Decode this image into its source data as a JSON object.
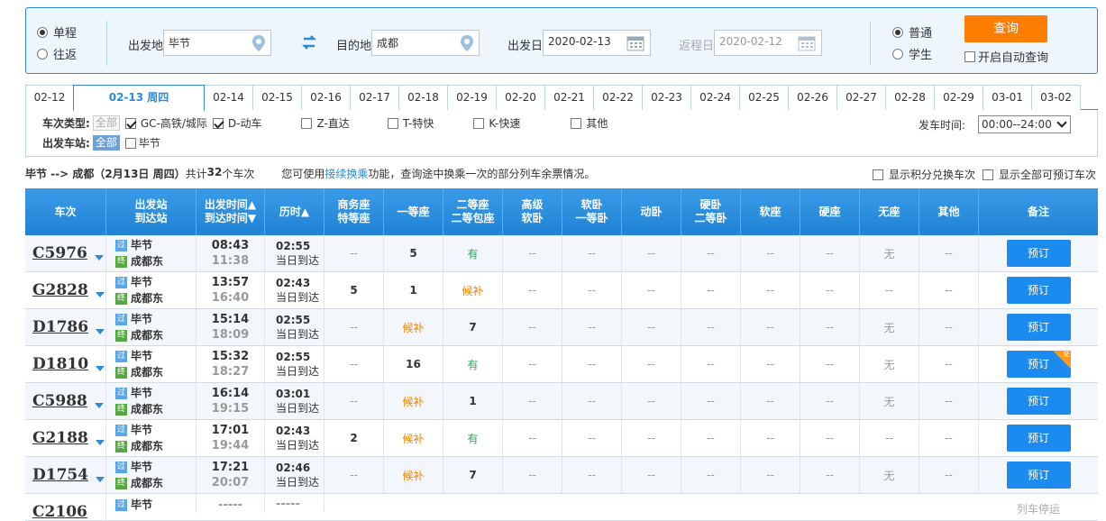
{
  "search": {
    "trip_types": [
      "单程",
      "往返"
    ],
    "from_label": "出发地",
    "from_value": "毕节",
    "to_label": "目的地",
    "to_value": "成都",
    "depart_label": "出发日",
    "depart_value": "2020-02-13",
    "return_label": "返程日",
    "return_value": "2020-02-12",
    "passenger_types": [
      "普通",
      "学生"
    ],
    "query_label": "查询",
    "auto_query_label": "开启自动查询"
  },
  "date_tabs": [
    "02-12",
    "02-13 周四",
    "02-14",
    "02-15",
    "02-16",
    "02-17",
    "02-18",
    "02-19",
    "02-20",
    "02-21",
    "02-22",
    "02-23",
    "02-24",
    "02-25",
    "02-26",
    "02-27",
    "02-28",
    "02-29",
    "03-01",
    "03-02"
  ],
  "filters": {
    "type_label": "车次类型:",
    "all_label": "全部",
    "types": [
      {
        "label": "GC-高铁/城际",
        "checked": true
      },
      {
        "label": "D-动车",
        "checked": true
      },
      {
        "label": "Z-直达",
        "checked": false
      },
      {
        "label": "T-特快",
        "checked": false
      },
      {
        "label": "K-快速",
        "checked": false
      },
      {
        "label": "其他",
        "checked": false
      }
    ],
    "station_label": "出发车站:",
    "station_all": "全部",
    "station": "毕节",
    "time_label": "发车时间:",
    "time_value": "00:00--24:00"
  },
  "summary": {
    "route": "毕节 --> 成都（2月13日 周四）",
    "count_pre": "共计",
    "count": "32",
    "count_post": "个车次",
    "tip_pre": "您可使用",
    "tip_link": "接续换乘",
    "tip_post": "功能，查询途中换乘一次的部分列车余票情况。",
    "opt1": "显示积分兑换车次",
    "opt2": "显示全部可预订车次"
  },
  "table": {
    "headers": [
      {
        "l1": "车次",
        "l2": ""
      },
      {
        "l1": "出发站",
        "l2": "到达站"
      },
      {
        "l1": "出发时间▲",
        "l2": "到达时间▼"
      },
      {
        "l1": "历时▲",
        "l2": ""
      },
      {
        "l1": "商务座",
        "l2": "特等座"
      },
      {
        "l1": "一等座",
        "l2": ""
      },
      {
        "l1": "二等座",
        "l2": "二等包座"
      },
      {
        "l1": "高级",
        "l2": "软卧"
      },
      {
        "l1": "软卧",
        "l2": "一等卧"
      },
      {
        "l1": "动卧",
        "l2": ""
      },
      {
        "l1": "硬卧",
        "l2": "二等卧"
      },
      {
        "l1": "软座",
        "l2": ""
      },
      {
        "l1": "硬座",
        "l2": ""
      },
      {
        "l1": "无座",
        "l2": ""
      },
      {
        "l1": "其他",
        "l2": ""
      },
      {
        "l1": "备注",
        "l2": ""
      }
    ],
    "pass_icon": "过",
    "end_icon": "终",
    "book_label": "预订",
    "badge_label": "兑",
    "rows": [
      {
        "no": "C5976",
        "from": "毕节",
        "to": "成都东",
        "dep": "08:43",
        "arr": "11:38",
        "dur": "02:55",
        "note": "当日到达",
        "seats": [
          "--",
          "5",
          "有",
          "--",
          "--",
          "--",
          "--",
          "--",
          "--",
          "无",
          "--"
        ],
        "badge": false
      },
      {
        "no": "G2828",
        "from": "毕节",
        "to": "成都东",
        "dep": "13:57",
        "arr": "16:40",
        "dur": "02:43",
        "note": "当日到达",
        "seats": [
          "5",
          "1",
          "候补",
          "--",
          "--",
          "--",
          "--",
          "--",
          "--",
          "--",
          "--"
        ],
        "badge": false
      },
      {
        "no": "D1786",
        "from": "毕节",
        "to": "成都东",
        "dep": "15:14",
        "arr": "18:09",
        "dur": "02:55",
        "note": "当日到达",
        "seats": [
          "--",
          "候补",
          "7",
          "--",
          "--",
          "--",
          "--",
          "--",
          "--",
          "无",
          "--"
        ],
        "badge": false
      },
      {
        "no": "D1810",
        "from": "毕节",
        "to": "成都东",
        "dep": "15:32",
        "arr": "18:27",
        "dur": "02:55",
        "note": "当日到达",
        "seats": [
          "--",
          "16",
          "有",
          "--",
          "--",
          "--",
          "--",
          "--",
          "--",
          "无",
          "--"
        ],
        "badge": true
      },
      {
        "no": "C5988",
        "from": "毕节",
        "to": "成都东",
        "dep": "16:14",
        "arr": "19:15",
        "dur": "03:01",
        "note": "当日到达",
        "seats": [
          "--",
          "候补",
          "1",
          "--",
          "--",
          "--",
          "--",
          "--",
          "--",
          "无",
          "--"
        ],
        "badge": false
      },
      {
        "no": "G2188",
        "from": "毕节",
        "to": "成都东",
        "dep": "17:01",
        "arr": "19:44",
        "dur": "02:43",
        "note": "当日到达",
        "seats": [
          "2",
          "候补",
          "有",
          "--",
          "--",
          "--",
          "--",
          "--",
          "--",
          "--",
          "--"
        ],
        "badge": false
      },
      {
        "no": "D1754",
        "from": "毕节",
        "to": "成都东",
        "dep": "17:21",
        "arr": "20:07",
        "dur": "02:46",
        "note": "当日到达",
        "seats": [
          "--",
          "候补",
          "7",
          "--",
          "--",
          "--",
          "--",
          "--",
          "--",
          "无",
          "--"
        ],
        "badge": false
      }
    ],
    "partial_row": {
      "no": "C2106",
      "from": "毕节",
      "dep": "-----",
      "dur": "-----",
      "remark": "列车停运"
    }
  },
  "colors": {
    "accent": "#2e8ad8",
    "query": "#ff7d00",
    "book": "#1b8bef",
    "available": "#26a65b",
    "waitlist": "#f08300"
  }
}
